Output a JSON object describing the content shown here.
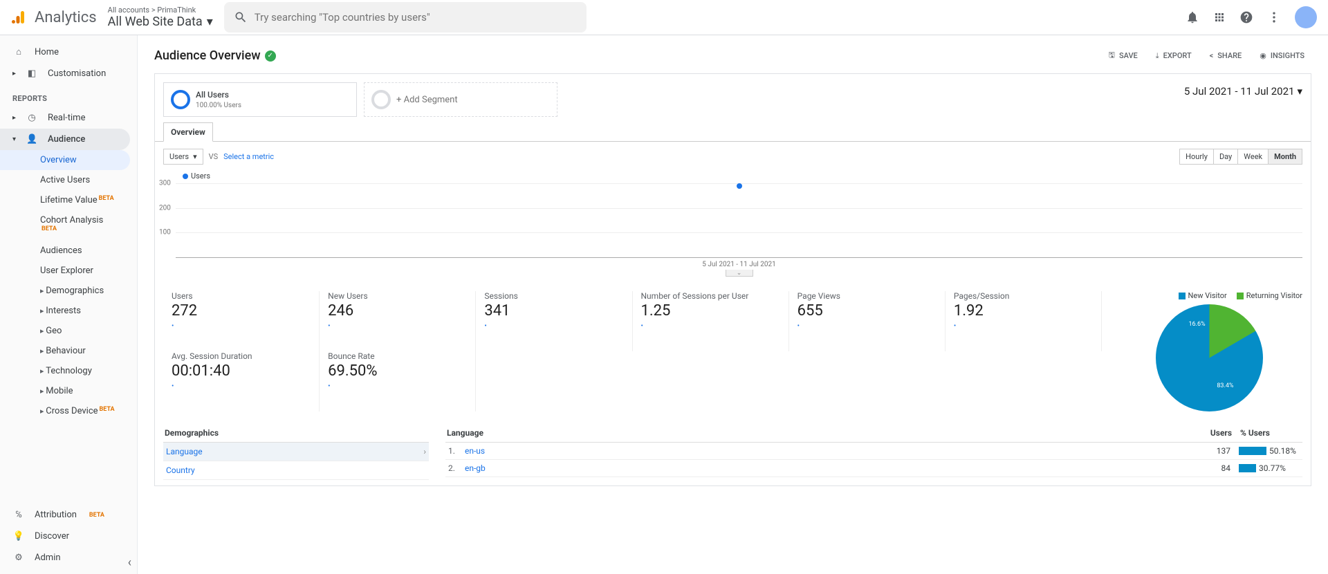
{
  "header": {
    "brand": "Analytics",
    "account_sub": "All accounts > PrimaThink",
    "account_main": "All Web Site Data",
    "search_placeholder": "Try searching \"Top countries by users\""
  },
  "sidebar": {
    "home": "Home",
    "customisation": "Customisation",
    "reports_label": "REPORTS",
    "realtime": "Real-time",
    "audience": "Audience",
    "audience_items": {
      "overview": "Overview",
      "active_users": "Active Users",
      "lifetime_value": "Lifetime Value",
      "lifetime_beta": "BETA",
      "cohort": "Cohort Analysis",
      "cohort_beta": "BETA",
      "audiences": "Audiences",
      "user_explorer": "User Explorer",
      "demographics": "Demographics",
      "interests": "Interests",
      "geo": "Geo",
      "behaviour": "Behaviour",
      "technology": "Technology",
      "mobile": "Mobile",
      "cross_device": "Cross Device",
      "cross_beta": "BETA"
    },
    "attribution": "Attribution",
    "attribution_beta": "BETA",
    "discover": "Discover",
    "admin": "Admin"
  },
  "toolbar": {
    "title": "Audience Overview",
    "save": "SAVE",
    "export": "EXPORT",
    "share": "SHARE",
    "insights": "INSIGHTS"
  },
  "segments": {
    "all_users": "All Users",
    "all_users_pct": "100.00% Users",
    "add": "+ Add Segment"
  },
  "date_range": "5 Jul 2021 - 11 Jul 2021",
  "tabs": {
    "overview": "Overview"
  },
  "controls": {
    "metric": "Users",
    "vs": "VS",
    "select_metric": "Select a metric",
    "hourly": "Hourly",
    "day": "Day",
    "week": "Week",
    "month": "Month"
  },
  "chart_data": {
    "type": "line",
    "series_name": "Users",
    "ylim": [
      0,
      300
    ],
    "yticks": [
      100,
      200,
      300
    ],
    "x_label": "5 Jul 2021 - 11 Jul 2021",
    "points": [
      {
        "x_frac": 0.5,
        "y": 290
      }
    ]
  },
  "metrics": [
    {
      "label": "Users",
      "value": "272"
    },
    {
      "label": "New Users",
      "value": "246"
    },
    {
      "label": "Sessions",
      "value": "341"
    },
    {
      "label": "Number of Sessions per User",
      "value": "1.25"
    },
    {
      "label": "Page Views",
      "value": "655"
    },
    {
      "label": "Pages/Session",
      "value": "1.92"
    },
    {
      "label": "Avg. Session Duration",
      "value": "00:01:40"
    },
    {
      "label": "Bounce Rate",
      "value": "69.50%"
    }
  ],
  "pie": {
    "new": "New Visitor",
    "returning": "Returning Visitor",
    "new_pct": "83.4%",
    "ret_pct": "16.6%"
  },
  "bottom": {
    "demographics": "Demographics",
    "language": "Language",
    "country": "Country",
    "lang_header": "Language",
    "users_header": "Users",
    "pct_header": "% Users",
    "rows": [
      {
        "idx": "1.",
        "lang": "en-us",
        "users": "137",
        "pct": "50.18%",
        "bar": 40
      },
      {
        "idx": "2.",
        "lang": "en-gb",
        "users": "84",
        "pct": "30.77%",
        "bar": 25
      }
    ]
  }
}
